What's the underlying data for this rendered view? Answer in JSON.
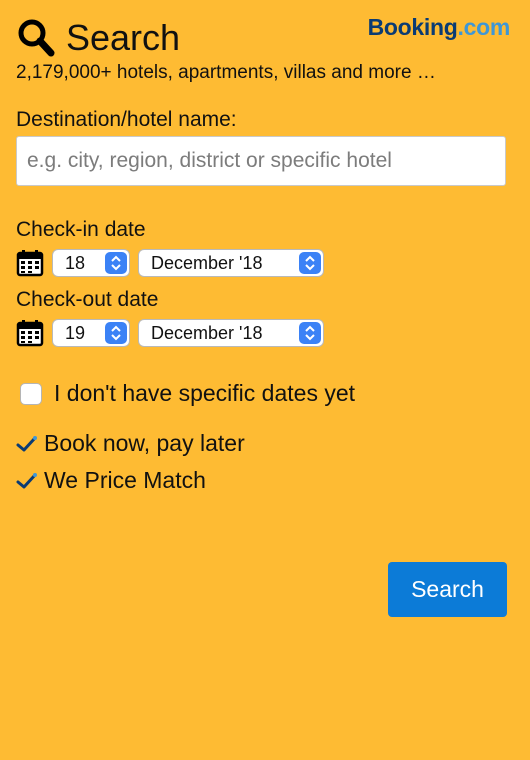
{
  "header": {
    "title": "Search",
    "logo_brand": "Booking",
    "logo_suffix": ".com",
    "tagline": "2,179,000+ hotels, apartments, villas and more …"
  },
  "destination": {
    "label": "Destination/hotel name:",
    "placeholder": "e.g. city, region, district or specific hotel",
    "value": ""
  },
  "checkin": {
    "label": "Check-in date",
    "day": "18",
    "month": "December '18"
  },
  "checkout": {
    "label": "Check-out date",
    "day": "19",
    "month": "December '18"
  },
  "no_dates": {
    "label": "I don't have specific dates yet",
    "checked": false
  },
  "perks": [
    "Book now, pay later",
    "We Price Match"
  ],
  "search_button": "Search",
  "colors": {
    "background": "#febb33",
    "brand_dark": "#0b3b73",
    "brand_light": "#3f97d6",
    "button": "#0c7bd7",
    "stepper": "#3b82f6"
  }
}
